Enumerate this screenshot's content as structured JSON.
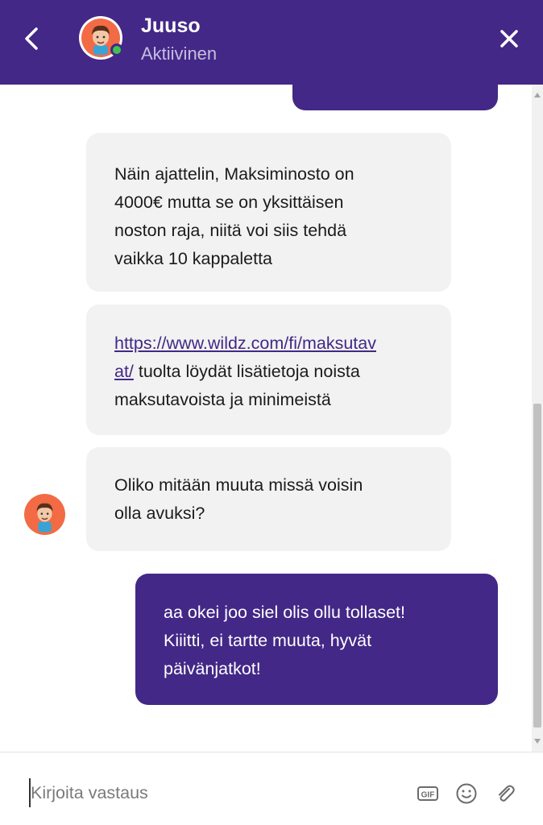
{
  "header": {
    "agent_name": "Juuso",
    "agent_status": "Aktiivinen",
    "accent_color": "#432887",
    "online_color": "#3fc24f"
  },
  "messages": [
    {
      "sender": "agent",
      "lines": [
        "Näin ajattelin, Maksiminosto on",
        "4000€ mutta se on yksittäisen",
        "noston raja, niitä voi siis tehdä",
        "vaikka 10 kappaletta"
      ]
    },
    {
      "sender": "agent",
      "link_line1": "https://www.wildz.com/fi/maksutav",
      "link_line2": "at/",
      "line2_rest": " tuolta löydät lisätietoja noista",
      "line3": "maksutavoista ja minimeistä"
    },
    {
      "sender": "agent",
      "lines": [
        "Oliko mitään muuta missä voisin",
        "olla avuksi?"
      ]
    },
    {
      "sender": "user",
      "lines": [
        "aa okei joo siel olis ollu tollaset!",
        "Kiiitti, ei tartte muuta, hyvät",
        "päivänjatkot!"
      ]
    }
  ],
  "composer": {
    "placeholder": "Kirjoita vastaus",
    "icons": [
      "gif-icon",
      "emoji-icon",
      "attachment-icon"
    ]
  }
}
